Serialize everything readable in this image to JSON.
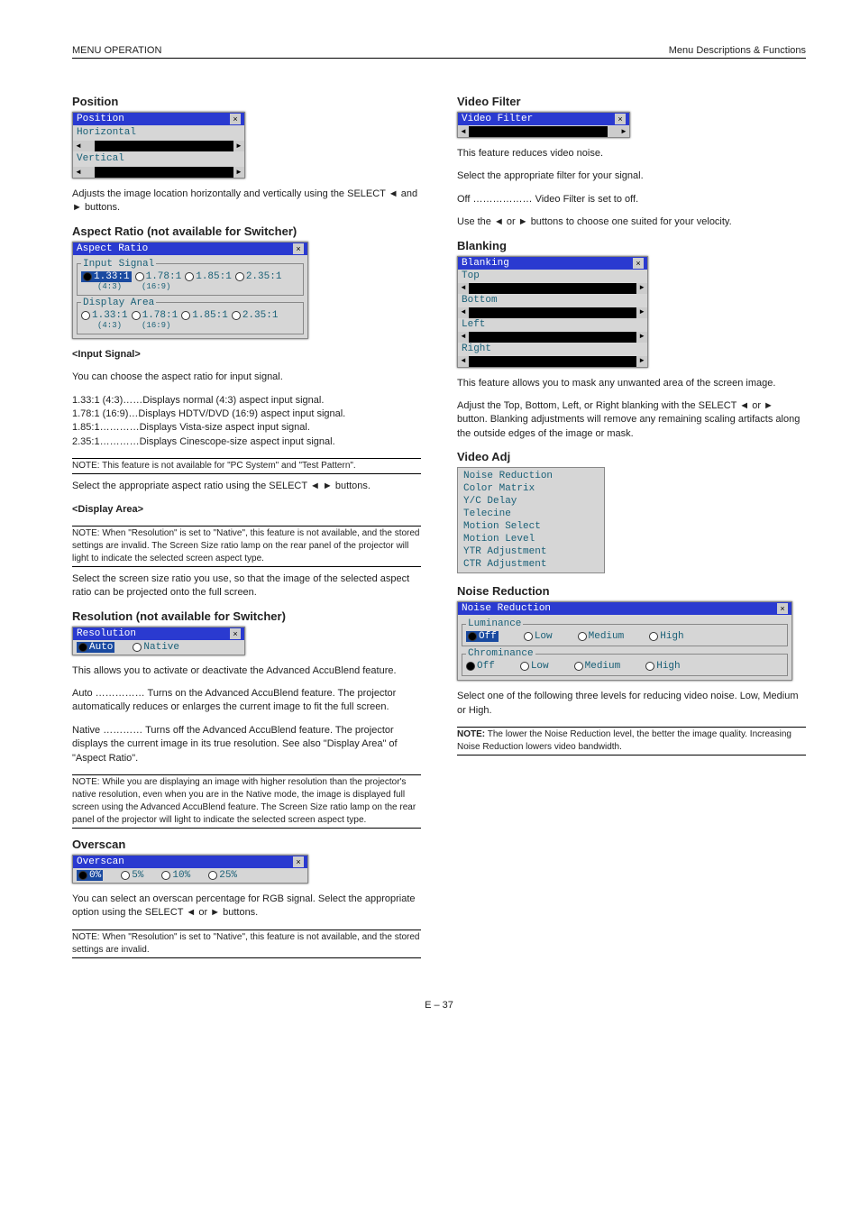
{
  "header": {
    "left": "MENU OPERATION",
    "right": "Menu Descriptions & Functions"
  },
  "sections": {
    "position": {
      "title": "Position",
      "dialog_title": "Position",
      "row1": "Horizontal",
      "row2": "Vertical",
      "desc": "Adjusts the image location horizontally and vertically using the SELECT ◄ and ► buttons."
    },
    "aspect": {
      "title": "Aspect Ratio (not available for Switcher)",
      "dialog_title": "Aspect Ratio",
      "input_signal_legend": "Input Signal",
      "display_area_legend": "Display Area",
      "opts": [
        "1.33:1",
        "1.78:1",
        "1.85:1",
        "2.35:1"
      ],
      "sub_opts": [
        "(4:3)",
        "(16:9)"
      ],
      "subtitle_input": "<Input Signal>",
      "desc_input": "You can choose the aspect ratio for input signal.",
      "desc_input_values": [
        "1.33:1 (4:3)……Displays normal (4:3) aspect input signal.",
        "1.78:1 (16:9)…Displays HDTV/DVD (16:9) aspect input signal.",
        "1.85:1…………Displays Vista-size aspect input signal.",
        "2.35:1…………Displays Cinescope-size aspect input signal."
      ],
      "note_aspect": "NOTE: This feature is not available for \"PC System\" and \"Test Pattern\".",
      "note_aspect_hint": "Select the appropriate aspect ratio using the SELECT ◄ ► buttons.",
      "subtitle_display": "<Display Area>",
      "desc_display_area": "Select the screen size ratio you use, so that the image of the selected aspect ratio can be projected onto the full screen.",
      "note_display_area": "NOTE: When \"Resolution\" is set to \"Native\", this feature is not available, and the stored settings are invalid. The Screen Size ratio lamp on the rear panel of the projector will light to indicate the selected screen aspect type."
    },
    "resolution": {
      "title": "Resolution (not available for Switcher)",
      "dialog_title": "Resolution",
      "opts": [
        "Auto",
        "Native"
      ],
      "body1": "This allows you to activate or deactivate the Advanced AccuBlend feature.",
      "body2_auto": "Auto …………… Turns on the Advanced AccuBlend feature. The projector automatically reduces or enlarges the current image to fit the full screen.",
      "body2_native": "Native ………… Turns off the Advanced AccuBlend feature. The projector displays the current image in its true resolution. See also \"Display Area\" of \"Aspect Ratio\".",
      "note_resolution": "NOTE: While you are displaying an image with higher resolution than the projector's native resolution, even when you are in the Native mode, the image is displayed full screen using the Advanced AccuBlend feature. The Screen Size ratio lamp on the rear panel of the projector will light to indicate the selected screen aspect type."
    },
    "overscan": {
      "title": "Overscan",
      "dialog_title": "Overscan",
      "opts": [
        "0%",
        "5%",
        "10%",
        "25%"
      ],
      "body": "You can select an overscan percentage for RGB signal. Select the appropriate option using the SELECT ◄ or ► buttons.",
      "note_overscan": "NOTE: When \"Resolution\" is set to \"Native\", this feature is not available, and the stored settings are invalid."
    },
    "videofilter": {
      "title": "Video Filter",
      "dialog_title": "Video Filter",
      "body1": "This feature reduces video noise.",
      "body2": "Select the appropriate filter for your signal.",
      "body3_off": "Off ……………… Video Filter is set to off.",
      "body3_use": "Use the ◄ or ► buttons to choose one suited for your velocity."
    },
    "blanking": {
      "title": "Blanking",
      "dialog_title": "Blanking",
      "rows": [
        "Top",
        "Bottom",
        "Left",
        "Right"
      ],
      "desc": "This feature allows you to mask any unwanted area of the screen image.",
      "desc2": "Adjust the Top, Bottom, Left, or Right blanking with the SELECT ◄ or ► button. Blanking adjustments will remove any remaining scaling artifacts along the outside edges of the image or mask."
    },
    "videoadj": {
      "title": "Video Adj",
      "menu_items": [
        "Noise Reduction",
        "Color Matrix",
        "Y/C Delay",
        "Telecine",
        "Motion Select",
        "Motion Level",
        "YTR Adjustment",
        "CTR Adjustment"
      ]
    },
    "noise_reduction": {
      "title": "Noise Reduction",
      "dialog_title": "Noise Reduction",
      "lum_legend": "Luminance",
      "chr_legend": "Chrominance",
      "opts": [
        "Off",
        "Low",
        "Medium",
        "High"
      ],
      "body1": "Select one of the following three levels for reducing video noise. Low, Medium or High.",
      "note_nr_body": "The lower the Noise Reduction level, the better the image quality. Increasing Noise Reduction lowers video bandwidth.",
      "note_nr_label": "NOTE:"
    }
  },
  "page_number": "E – 37"
}
